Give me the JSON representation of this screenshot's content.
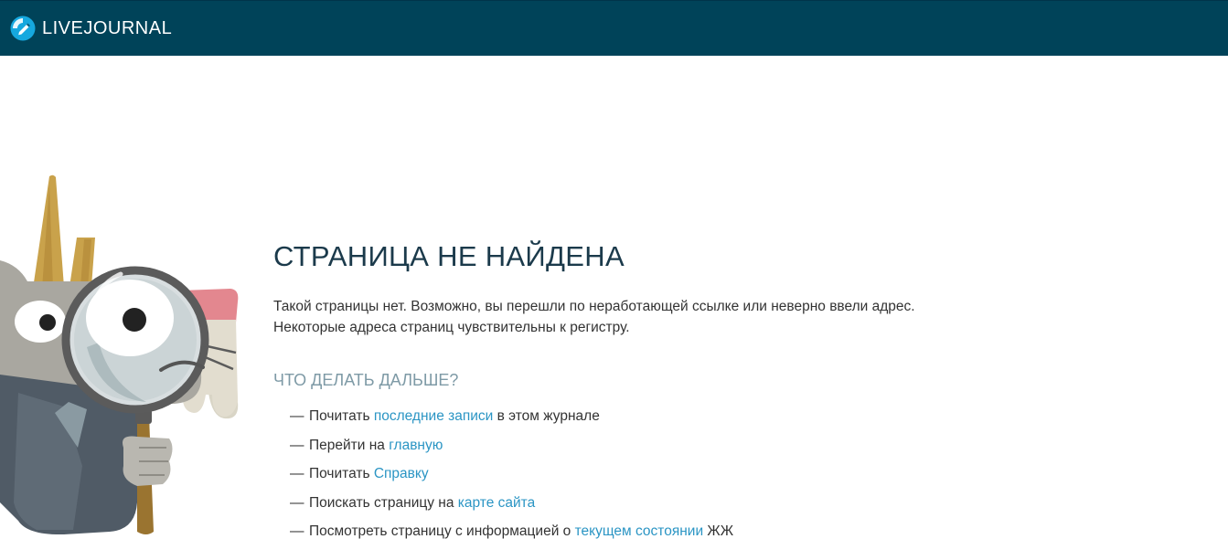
{
  "header": {
    "logo_text": "LIVEJOURNAL",
    "logo_icon": "livejournal-pencil-icon",
    "background_color": "#004359"
  },
  "mascot": {
    "icon": "frank-goat-with-magnifying-glass"
  },
  "main": {
    "title": "СТРАНИЦА НЕ НАЙДЕНА",
    "description": "Такой страницы нет. Возможно, вы перешли по неработающей ссылке или неверно ввели адрес. Некоторые адреса страниц чувствительны к регистру.",
    "subtitle": "ЧТО ДЕЛАТЬ ДАЛЬШЕ?",
    "dash": "—",
    "actions": [
      {
        "before": "Почитать ",
        "link": "последние записи",
        "after": " в этом журнале"
      },
      {
        "before": "Перейти на ",
        "link": "главную",
        "after": ""
      },
      {
        "before": "Почитать ",
        "link": "Справку",
        "after": ""
      },
      {
        "before": "Поискать страницу на ",
        "link": "карте сайта",
        "after": ""
      },
      {
        "before": "Посмотреть страницу с информацией о ",
        "link": "текущем состоянии",
        "after": " ЖЖ"
      }
    ],
    "link_color": "#2b95c4"
  }
}
